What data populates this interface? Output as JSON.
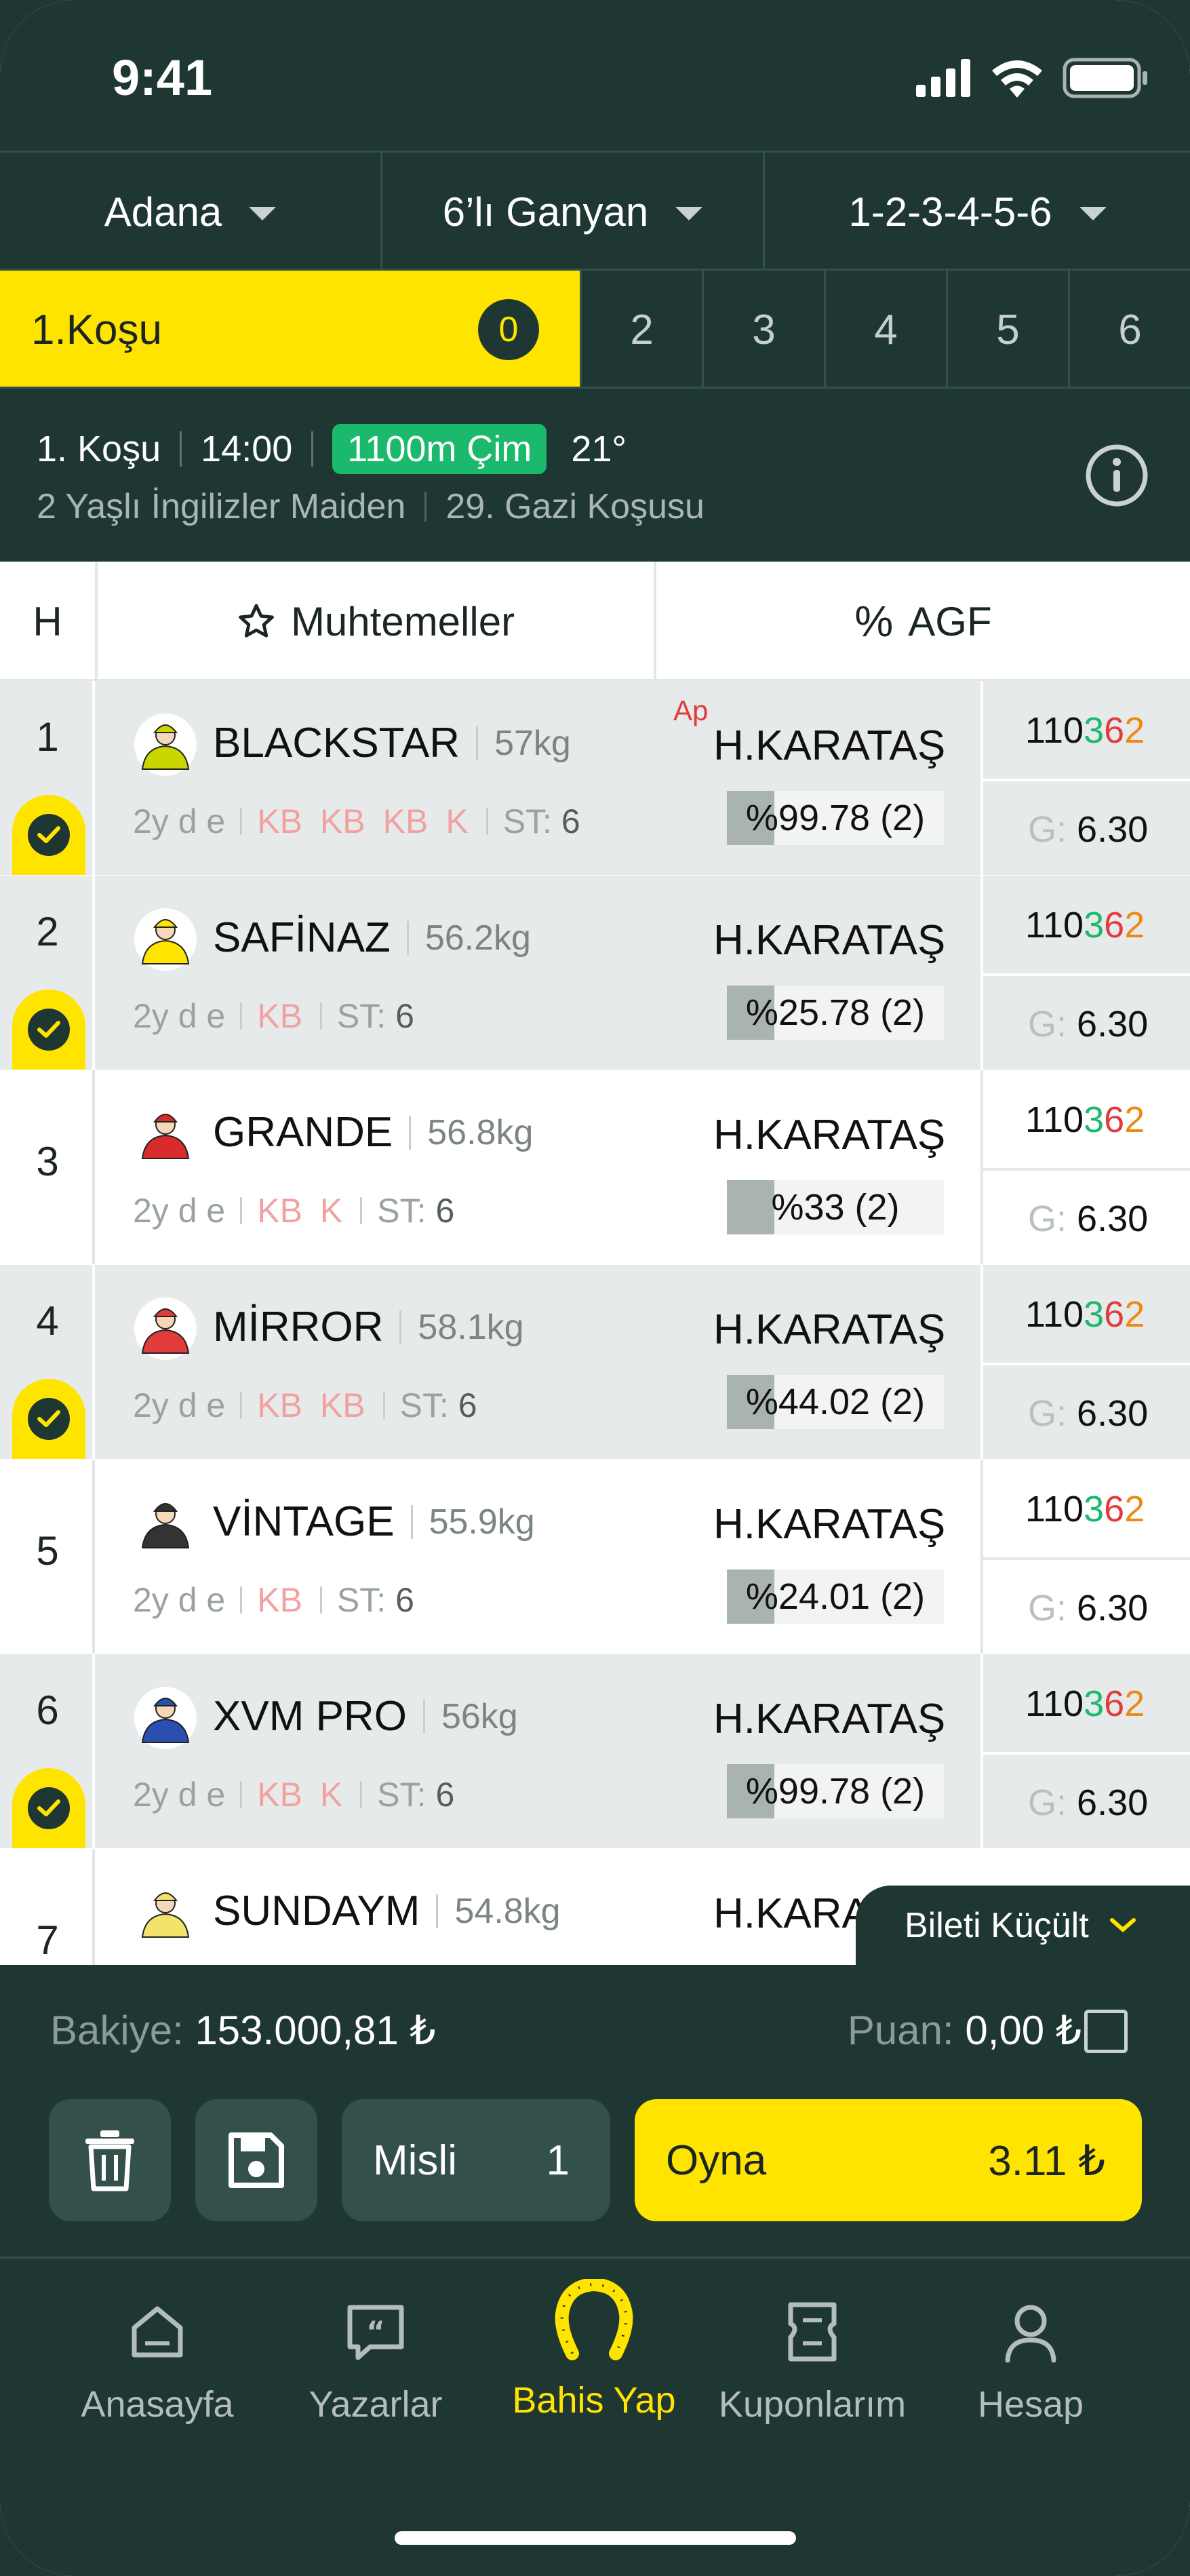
{
  "status_bar": {
    "time": "9:41"
  },
  "filters": {
    "city": "Adana",
    "bet_type": "6’lı Ganyan",
    "races": "1-2-3-4-5-6"
  },
  "race_tabs": {
    "active_label": "1.Koşu",
    "active_count": "0",
    "tabs": [
      "2",
      "3",
      "4",
      "5",
      "6"
    ]
  },
  "race_info": {
    "race": "1. Koşu",
    "time": "14:00",
    "track": "1100m Çim",
    "temp": "21°",
    "category": "2 Yaşlı İngilizler Maiden",
    "name": "29. Gazi Koşusu"
  },
  "table_header": {
    "no": "H",
    "favorites": "Muhtemeller",
    "agf": "AGF",
    "star_icon": "star-icon",
    "percent_icon": "%"
  },
  "horses": [
    {
      "no": "1",
      "name": "BLACKSTAR",
      "weight": "57kg",
      "age": "2y d e",
      "form": [
        "KB",
        "KB",
        "KB",
        "K"
      ],
      "st_label": "ST:",
      "st": "6",
      "ap": "Ap",
      "jockey": "H.KARATAŞ",
      "agf": "%99.78 (2)",
      "agf_pct": 22,
      "odds_a": "110",
      "odds_b": "3",
      "odds_c": "6",
      "odds_d": "2",
      "g_label": "G:",
      "g_value": "6.30",
      "selected": true,
      "silk": "#c9d600"
    },
    {
      "no": "2",
      "name": "SAFİNAZ",
      "weight": "56.2kg",
      "age": "2y d e",
      "form": [
        "KB"
      ],
      "st_label": "ST:",
      "st": "6",
      "jockey": "H.KARATAŞ",
      "agf": "%25.78 (2)",
      "agf_pct": 22,
      "odds_a": "110",
      "odds_b": "3",
      "odds_c": "6",
      "odds_d": "2",
      "g_label": "G:",
      "g_value": "6.30",
      "selected": true,
      "silk": "#ffe400"
    },
    {
      "no": "3",
      "name": "GRANDE",
      "weight": "56.8kg",
      "age": "2y d e",
      "form": [
        "KB",
        "K"
      ],
      "st_label": "ST:",
      "st": "6",
      "jockey": "H.KARATAŞ",
      "agf": "%33 (2)",
      "agf_pct": 22,
      "odds_a": "110",
      "odds_b": "3",
      "odds_c": "6",
      "odds_d": "2",
      "g_label": "G:",
      "g_value": "6.30",
      "selected": false,
      "silk": "#d92b2b"
    },
    {
      "no": "4",
      "name": "MİRROR",
      "weight": "58.1kg",
      "age": "2y d e",
      "form": [
        "KB",
        "KB"
      ],
      "st_label": "ST:",
      "st": "6",
      "jockey": "H.KARATAŞ",
      "agf": "%44.02 (2)",
      "agf_pct": 22,
      "odds_a": "110",
      "odds_b": "3",
      "odds_c": "6",
      "odds_d": "2",
      "g_label": "G:",
      "g_value": "6.30",
      "selected": true,
      "silk": "#e23b3b"
    },
    {
      "no": "5",
      "name": "VİNTAGE",
      "weight": "55.9kg",
      "age": "2y d e",
      "form": [
        "KB"
      ],
      "st_label": "ST:",
      "st": "6",
      "jockey": "H.KARATAŞ",
      "agf": "%24.01 (2)",
      "agf_pct": 22,
      "odds_a": "110",
      "odds_b": "3",
      "odds_c": "6",
      "odds_d": "2",
      "g_label": "G:",
      "g_value": "6.30",
      "selected": false,
      "silk": "#333333"
    },
    {
      "no": "6",
      "name": "XVM PRO",
      "weight": "56kg",
      "age": "2y d e",
      "form": [
        "KB",
        "K"
      ],
      "st_label": "ST:",
      "st": "6",
      "jockey": "H.KARATAŞ",
      "agf": "%99.78 (2)",
      "agf_pct": 22,
      "odds_a": "110",
      "odds_b": "3",
      "odds_c": "6",
      "odds_d": "2",
      "g_label": "G:",
      "g_value": "6.30",
      "selected": true,
      "silk": "#2b4fb0"
    },
    {
      "no": "7",
      "name": "SUNDAYM",
      "weight": "54.8kg",
      "jockey": "H.KARA",
      "silk": "#f2e36a"
    }
  ],
  "shrink_ticket": "Bileti Küçült",
  "bottom_panel": {
    "balance_label": "Bakiye:",
    "balance": "153.000,81 ₺",
    "points_label": "Puan:",
    "points": "0,00 ₺",
    "multiplier_label": "Misli",
    "multiplier": "1",
    "play_label": "Oyna",
    "play_amount": "3.11 ₺"
  },
  "nav": [
    {
      "label": "Anasayfa",
      "icon": "home-icon"
    },
    {
      "label": "Yazarlar",
      "icon": "quote-icon"
    },
    {
      "label": "Bahis Yap",
      "icon": "horseshoe-icon",
      "active": true
    },
    {
      "label": "Kuponlarım",
      "icon": "ticket-icon"
    },
    {
      "label": "Hesap",
      "icon": "user-icon"
    }
  ],
  "colors": {
    "dark": "#1f3733",
    "accent": "#ffe400",
    "green": "#1ab96b",
    "red": "#e23b3b",
    "orange": "#ee8a12"
  }
}
